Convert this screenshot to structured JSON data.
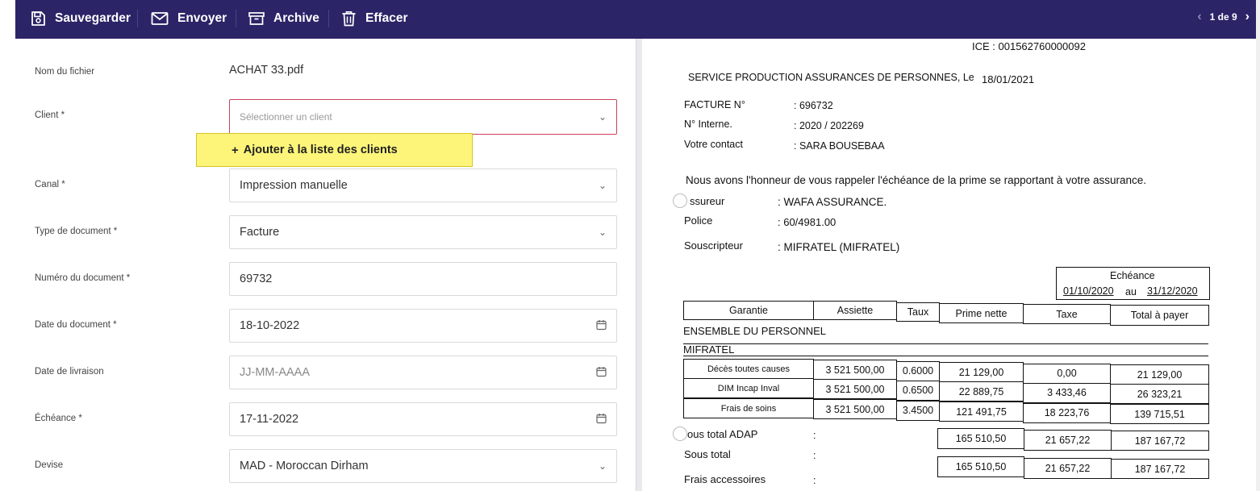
{
  "toolbar": {
    "save": "Sauvegarder",
    "send": "Envoyer",
    "archive": "Archive",
    "delete": "Effacer",
    "pager": "1 de 9"
  },
  "form": {
    "filename_label": "Nom du fichier",
    "filename_value": "ACHAT 33.pdf",
    "client_label": "Client *",
    "client_placeholder": "Sélectionner un client",
    "add_client": "Ajouter à la liste des clients",
    "canal_label": "Canal *",
    "canal_value": "Impression manuelle",
    "doctype_label": "Type de document *",
    "doctype_value": "Facture",
    "docnum_label": "Numéro du document *",
    "docnum_value": "69732",
    "docdate_label": "Date du document *",
    "docdate_value": "18-10-2022",
    "delivery_label": "Date de livraison",
    "delivery_placeholder": "JJ-MM-AAAA",
    "due_label": "Échéance *",
    "due_value": "17-11-2022",
    "currency_label": "Devise",
    "currency_value": "MAD - Moroccan Dirham"
  },
  "document": {
    "ice": "ICE : 001562760000092",
    "service": "SERVICE PRODUCTION ASSURANCES DE PERSONNES, Le",
    "service_date": "18/01/2021",
    "facture_label": "FACTURE N°",
    "facture_value": ":   696732",
    "interne_label": "N° Interne.",
    "interne_value": ":   2020 / 202269",
    "contact_label": "Votre contact",
    "contact_value": ":   SARA BOUSEBAA",
    "message": "Nous avons l'honneur de vous rappeler l'échéance de la prime se rapportant à votre assurance.",
    "assureur_label": "ssureur",
    "assureur_value": ":   WAFA ASSURANCE.",
    "police_label": "Police",
    "police_value": ":   60/4981.00",
    "souscripteur_label": "Souscripteur",
    "souscripteur_value": ":   MIFRATEL (MIFRATEL)",
    "echeance_title": "Echéance",
    "echeance_from": "01/10/2020",
    "echeance_au": "au",
    "echeance_to": "31/12/2020",
    "headers": [
      "Garantie",
      "Assiette",
      "Taux",
      "Prime nette",
      "Taxe",
      "Total à payer"
    ],
    "group": "ENSEMBLE DU PERSONNEL",
    "subgroup": "MIFRATEL",
    "rows": [
      {
        "garantie": "Décès toutes causes",
        "assiette": "3 521 500,00",
        "taux": "0.6000",
        "prime": "21 129,00",
        "taxe": "0,00",
        "total": "21 129,00"
      },
      {
        "garantie": "DIM Incap Inval",
        "assiette": "3 521 500,00",
        "taux": "0.6500",
        "prime": "22 889,75",
        "taxe": "3 433,46",
        "total": "26 323,21"
      },
      {
        "garantie": "Frais de soins",
        "assiette": "3 521 500,00",
        "taux": "3.4500",
        "prime": "121 491,75",
        "taxe": "18 223,76",
        "total": "139 715,51"
      }
    ],
    "subtotal_adap_label": "ous total ADAP",
    "subtotal_label": "Sous total",
    "frais_label": "Frais accessoires",
    "colon": ":",
    "subtotal_adap": {
      "prime": "165 510,50",
      "taxe": "21 657,22",
      "total": "187 167,72"
    },
    "subtotal": {
      "prime": "165 510,50",
      "taxe": "21 657,22",
      "total": "187 167,72"
    }
  }
}
